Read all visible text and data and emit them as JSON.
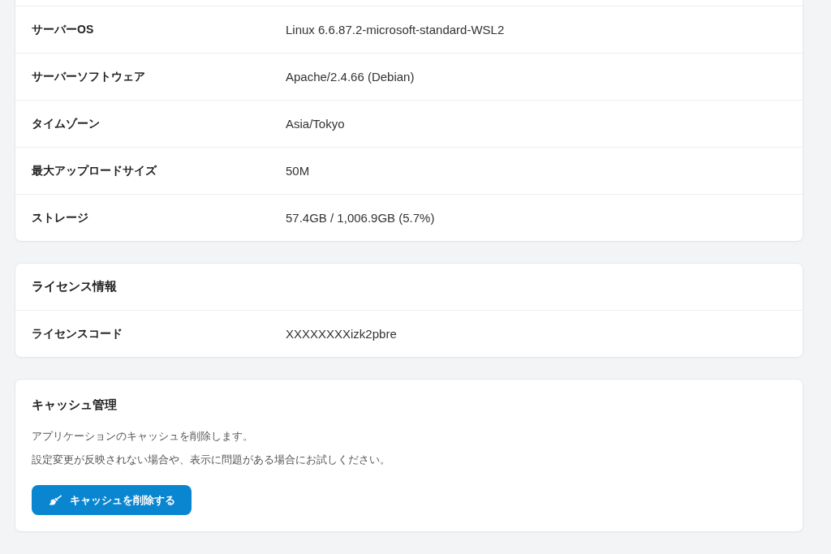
{
  "system_info": {
    "rows": [
      {
        "label": "サーバーOS",
        "value": "Linux 6.6.87.2-microsoft-standard-WSL2"
      },
      {
        "label": "サーバーソフトウェア",
        "value": "Apache/2.4.66 (Debian)"
      },
      {
        "label": "タイムゾーン",
        "value": "Asia/Tokyo"
      },
      {
        "label": "最大アップロードサイズ",
        "value": "50M"
      },
      {
        "label": "ストレージ",
        "value": "57.4GB / 1,006.9GB (5.7%)"
      }
    ]
  },
  "license_info": {
    "title": "ライセンス情報",
    "rows": [
      {
        "label": "ライセンスコード",
        "value": "XXXXXXXXizk2pbre"
      }
    ]
  },
  "cache_management": {
    "title": "キャッシュ管理",
    "description": [
      "アプリケーションのキャッシュを削除します。",
      "設定変更が反映されない場合や、表示に問題がある場合にお試しください。"
    ],
    "button": {
      "label": "キャッシュを削除する"
    }
  }
}
